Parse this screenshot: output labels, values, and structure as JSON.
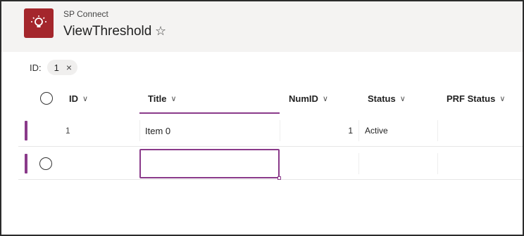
{
  "header": {
    "site_name": "SP Connect",
    "page_title": "ViewThreshold",
    "favorite_icon": "☆",
    "app_icon": "lightbulb-icon",
    "app_color": "#a4262c"
  },
  "filter": {
    "label": "ID:",
    "value": "1",
    "remove_icon": "×"
  },
  "grid": {
    "columns": [
      {
        "key": "ID",
        "label": "ID"
      },
      {
        "key": "Title",
        "label": "Title"
      },
      {
        "key": "NumID",
        "label": "NumID"
      },
      {
        "key": "Status",
        "label": "Status"
      },
      {
        "key": "PRFStatus",
        "label": "PRF Status"
      }
    ],
    "chevron": "∨",
    "rows": [
      {
        "ID": "1",
        "Title": "Item 0",
        "NumID": "1",
        "Status": "Active",
        "PRFStatus": ""
      },
      {
        "ID": "",
        "Title": "",
        "NumID": "",
        "Status": "",
        "PRFStatus": ""
      }
    ],
    "accent": "#8a3a8a"
  }
}
